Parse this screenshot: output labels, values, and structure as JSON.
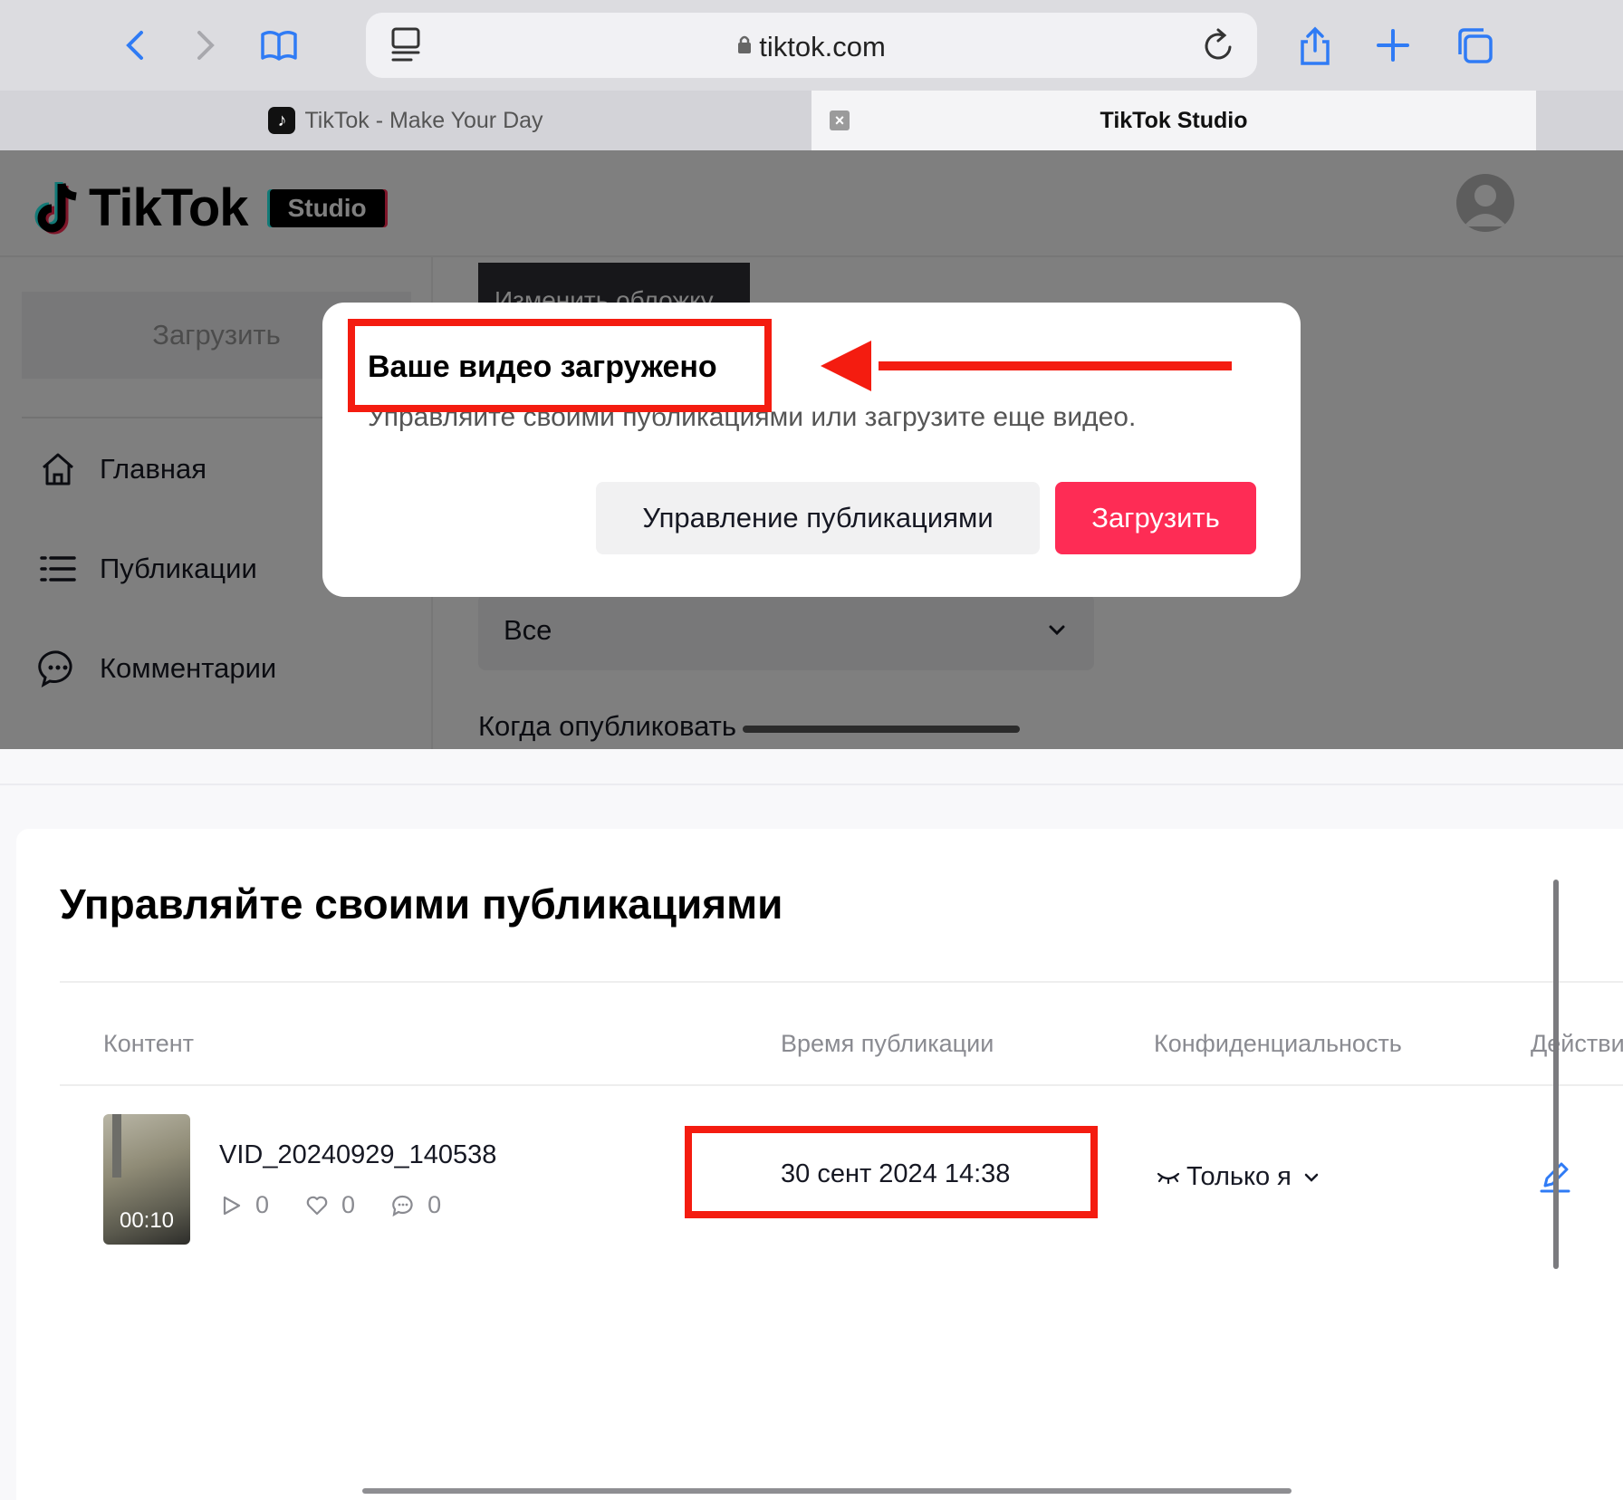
{
  "browser": {
    "url": "tiktok.com",
    "tabs": [
      {
        "title": "TikTok - Make Your Day"
      },
      {
        "title": "TikTok Studio"
      }
    ]
  },
  "studio": {
    "logo_text": "TikTok",
    "badge": "Studio",
    "sidebar": {
      "upload": "Загрузить",
      "items": [
        {
          "label": "Главная",
          "icon": "home-icon"
        },
        {
          "label": "Публикации",
          "icon": "list-icon"
        },
        {
          "label": "Комментарии",
          "icon": "comment-icon"
        }
      ]
    },
    "change_cover": "Изменить обложку",
    "select_value": "Все",
    "when_label": "Когда опубликовать"
  },
  "modal": {
    "title": "Ваше видео загружено",
    "description": "Управляйте своими публикациями или загрузите еще видео.",
    "manage_button": "Управление публикациями",
    "upload_button": "Загрузить"
  },
  "manage": {
    "title": "Управляйте своими публикациями",
    "columns": [
      "Контент",
      "Время публикации",
      "Конфиденциальность",
      "Действия"
    ],
    "rows": [
      {
        "name": "VID_20240929_140538",
        "duration": "00:10",
        "views": "0",
        "likes": "0",
        "comments": "0",
        "published": "30 сент 2024 14:38",
        "privacy": "Только я"
      }
    ]
  },
  "colors": {
    "brand_red": "#fe2c55",
    "annotation_red": "#f41c10",
    "safari_blue": "#2f7bf5"
  }
}
